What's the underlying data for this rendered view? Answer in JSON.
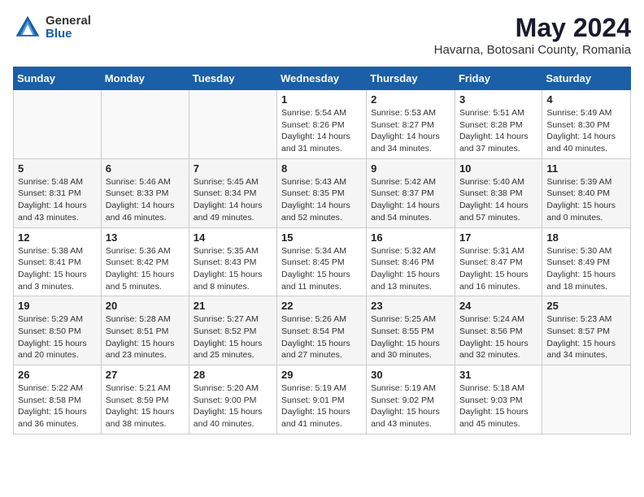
{
  "header": {
    "logo_general": "General",
    "logo_blue": "Blue",
    "month_title": "May 2024",
    "location": "Havarna, Botosani County, Romania"
  },
  "days_of_week": [
    "Sunday",
    "Monday",
    "Tuesday",
    "Wednesday",
    "Thursday",
    "Friday",
    "Saturday"
  ],
  "weeks": [
    [
      {
        "day": "",
        "info": ""
      },
      {
        "day": "",
        "info": ""
      },
      {
        "day": "",
        "info": ""
      },
      {
        "day": "1",
        "info": "Sunrise: 5:54 AM\nSunset: 8:26 PM\nDaylight: 14 hours and 31 minutes."
      },
      {
        "day": "2",
        "info": "Sunrise: 5:53 AM\nSunset: 8:27 PM\nDaylight: 14 hours and 34 minutes."
      },
      {
        "day": "3",
        "info": "Sunrise: 5:51 AM\nSunset: 8:28 PM\nDaylight: 14 hours and 37 minutes."
      },
      {
        "day": "4",
        "info": "Sunrise: 5:49 AM\nSunset: 8:30 PM\nDaylight: 14 hours and 40 minutes."
      }
    ],
    [
      {
        "day": "5",
        "info": "Sunrise: 5:48 AM\nSunset: 8:31 PM\nDaylight: 14 hours and 43 minutes."
      },
      {
        "day": "6",
        "info": "Sunrise: 5:46 AM\nSunset: 8:33 PM\nDaylight: 14 hours and 46 minutes."
      },
      {
        "day": "7",
        "info": "Sunrise: 5:45 AM\nSunset: 8:34 PM\nDaylight: 14 hours and 49 minutes."
      },
      {
        "day": "8",
        "info": "Sunrise: 5:43 AM\nSunset: 8:35 PM\nDaylight: 14 hours and 52 minutes."
      },
      {
        "day": "9",
        "info": "Sunrise: 5:42 AM\nSunset: 8:37 PM\nDaylight: 14 hours and 54 minutes."
      },
      {
        "day": "10",
        "info": "Sunrise: 5:40 AM\nSunset: 8:38 PM\nDaylight: 14 hours and 57 minutes."
      },
      {
        "day": "11",
        "info": "Sunrise: 5:39 AM\nSunset: 8:40 PM\nDaylight: 15 hours and 0 minutes."
      }
    ],
    [
      {
        "day": "12",
        "info": "Sunrise: 5:38 AM\nSunset: 8:41 PM\nDaylight: 15 hours and 3 minutes."
      },
      {
        "day": "13",
        "info": "Sunrise: 5:36 AM\nSunset: 8:42 PM\nDaylight: 15 hours and 5 minutes."
      },
      {
        "day": "14",
        "info": "Sunrise: 5:35 AM\nSunset: 8:43 PM\nDaylight: 15 hours and 8 minutes."
      },
      {
        "day": "15",
        "info": "Sunrise: 5:34 AM\nSunset: 8:45 PM\nDaylight: 15 hours and 11 minutes."
      },
      {
        "day": "16",
        "info": "Sunrise: 5:32 AM\nSunset: 8:46 PM\nDaylight: 15 hours and 13 minutes."
      },
      {
        "day": "17",
        "info": "Sunrise: 5:31 AM\nSunset: 8:47 PM\nDaylight: 15 hours and 16 minutes."
      },
      {
        "day": "18",
        "info": "Sunrise: 5:30 AM\nSunset: 8:49 PM\nDaylight: 15 hours and 18 minutes."
      }
    ],
    [
      {
        "day": "19",
        "info": "Sunrise: 5:29 AM\nSunset: 8:50 PM\nDaylight: 15 hours and 20 minutes."
      },
      {
        "day": "20",
        "info": "Sunrise: 5:28 AM\nSunset: 8:51 PM\nDaylight: 15 hours and 23 minutes."
      },
      {
        "day": "21",
        "info": "Sunrise: 5:27 AM\nSunset: 8:52 PM\nDaylight: 15 hours and 25 minutes."
      },
      {
        "day": "22",
        "info": "Sunrise: 5:26 AM\nSunset: 8:54 PM\nDaylight: 15 hours and 27 minutes."
      },
      {
        "day": "23",
        "info": "Sunrise: 5:25 AM\nSunset: 8:55 PM\nDaylight: 15 hours and 30 minutes."
      },
      {
        "day": "24",
        "info": "Sunrise: 5:24 AM\nSunset: 8:56 PM\nDaylight: 15 hours and 32 minutes."
      },
      {
        "day": "25",
        "info": "Sunrise: 5:23 AM\nSunset: 8:57 PM\nDaylight: 15 hours and 34 minutes."
      }
    ],
    [
      {
        "day": "26",
        "info": "Sunrise: 5:22 AM\nSunset: 8:58 PM\nDaylight: 15 hours and 36 minutes."
      },
      {
        "day": "27",
        "info": "Sunrise: 5:21 AM\nSunset: 8:59 PM\nDaylight: 15 hours and 38 minutes."
      },
      {
        "day": "28",
        "info": "Sunrise: 5:20 AM\nSunset: 9:00 PM\nDaylight: 15 hours and 40 minutes."
      },
      {
        "day": "29",
        "info": "Sunrise: 5:19 AM\nSunset: 9:01 PM\nDaylight: 15 hours and 41 minutes."
      },
      {
        "day": "30",
        "info": "Sunrise: 5:19 AM\nSunset: 9:02 PM\nDaylight: 15 hours and 43 minutes."
      },
      {
        "day": "31",
        "info": "Sunrise: 5:18 AM\nSunset: 9:03 PM\nDaylight: 15 hours and 45 minutes."
      },
      {
        "day": "",
        "info": ""
      }
    ]
  ]
}
